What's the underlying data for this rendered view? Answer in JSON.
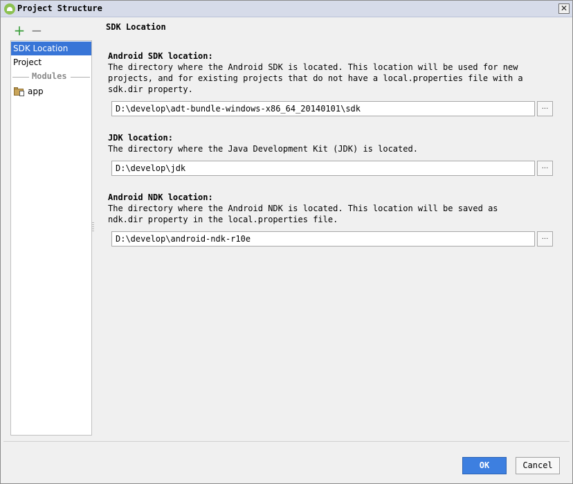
{
  "window": {
    "title": "Project Structure",
    "close_symbol": "✕"
  },
  "toolbar": {
    "add_symbol": "+",
    "remove_symbol": "−"
  },
  "sidebar": {
    "items": [
      {
        "label": "SDK Location",
        "selected": true
      },
      {
        "label": "Project",
        "selected": false
      }
    ],
    "modules_header": "Modules",
    "modules": [
      {
        "label": "app",
        "icon": "android-module-folder-icon"
      }
    ]
  },
  "main": {
    "page_title": "SDK Location",
    "sections": [
      {
        "title": "Android SDK location:",
        "description": "The directory where the Android SDK is located. This location will be used for new projects, and for existing projects that do not have a local.properties file with a sdk.dir property.",
        "value": "D:\\develop\\adt-bundle-windows-x86_64_20140101\\sdk",
        "browse_label": "..."
      },
      {
        "title": "JDK location:",
        "description": "The directory where the Java Development Kit (JDK) is located.",
        "value": "D:\\develop\\jdk",
        "browse_label": "..."
      },
      {
        "title": "Android NDK location:",
        "description": "The directory where the Android NDK is located. This location will be saved as ndk.dir property in the local.properties file.",
        "value": "D:\\develop\\android-ndk-r10e",
        "browse_label": "..."
      }
    ]
  },
  "footer": {
    "ok_label": "OK",
    "cancel_label": "Cancel"
  },
  "colors": {
    "accent": "#3875d7",
    "ok_button": "#3d7fe0",
    "add_icon": "#3a9e3a"
  }
}
